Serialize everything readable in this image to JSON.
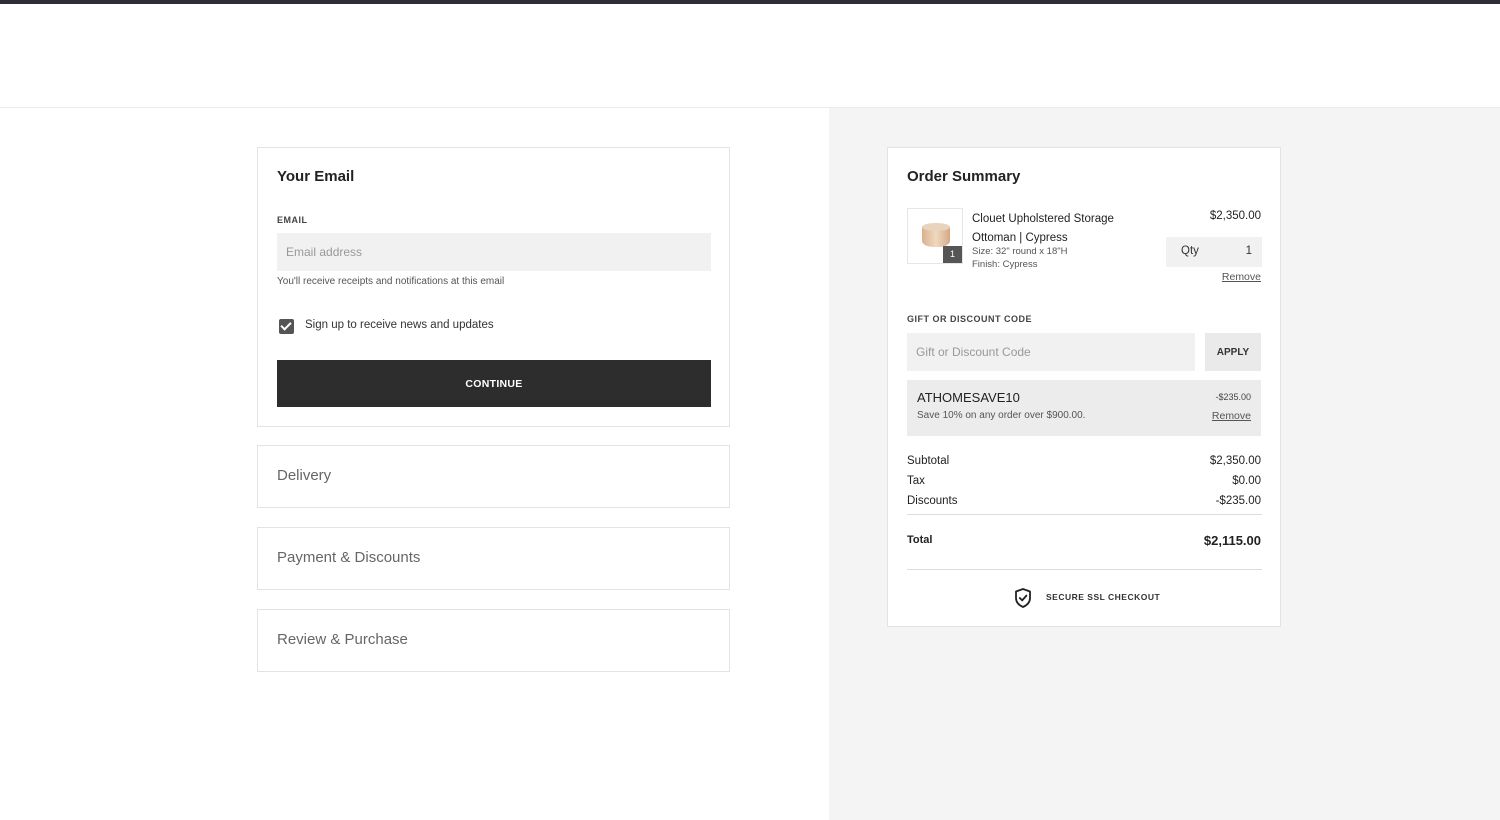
{
  "email_section": {
    "title": "Your Email",
    "email_label": "EMAIL",
    "email_placeholder": "Email address",
    "email_value": "",
    "hint": "You'll receive receipts and notifications at this email",
    "newsletter_label": "Sign up to receive news and updates",
    "newsletter_checked": true,
    "continue_label": "CONTINUE"
  },
  "steps": [
    {
      "label": "Delivery"
    },
    {
      "label": "Payment & Discounts"
    },
    {
      "label": "Review & Purchase"
    }
  ],
  "order_summary": {
    "title": "Order Summary",
    "item": {
      "name": "Clouet Upholstered Storage Ottoman | Cypress",
      "size": "Size: 32\" round x 18\"H",
      "finish": "Finish: Cypress",
      "price": "$2,350.00",
      "qty_label": "Qty",
      "qty": "1",
      "badge_count": "1",
      "remove_label": "Remove"
    },
    "discount": {
      "label": "GIFT OR DISCOUNT CODE",
      "placeholder": "Gift or Discount Code",
      "apply_label": "APPLY",
      "applied_code": "ATHOMESAVE10",
      "applied_desc": "Save 10% on any order over $900.00.",
      "applied_amount": "-$235.00",
      "remove_label": "Remove"
    },
    "totals": {
      "subtotal_label": "Subtotal",
      "subtotal": "$2,350.00",
      "tax_label": "Tax",
      "tax": "$0.00",
      "discounts_label": "Discounts",
      "discounts": "-$235.00",
      "total_label": "Total",
      "total": "$2,115.00"
    },
    "secure_label": "SECURE SSL CHECKOUT"
  },
  "colors": {
    "primary_button": "#2d2d2d",
    "summary_background": "#f4f4f4",
    "top_bar": "#2f2d33"
  }
}
